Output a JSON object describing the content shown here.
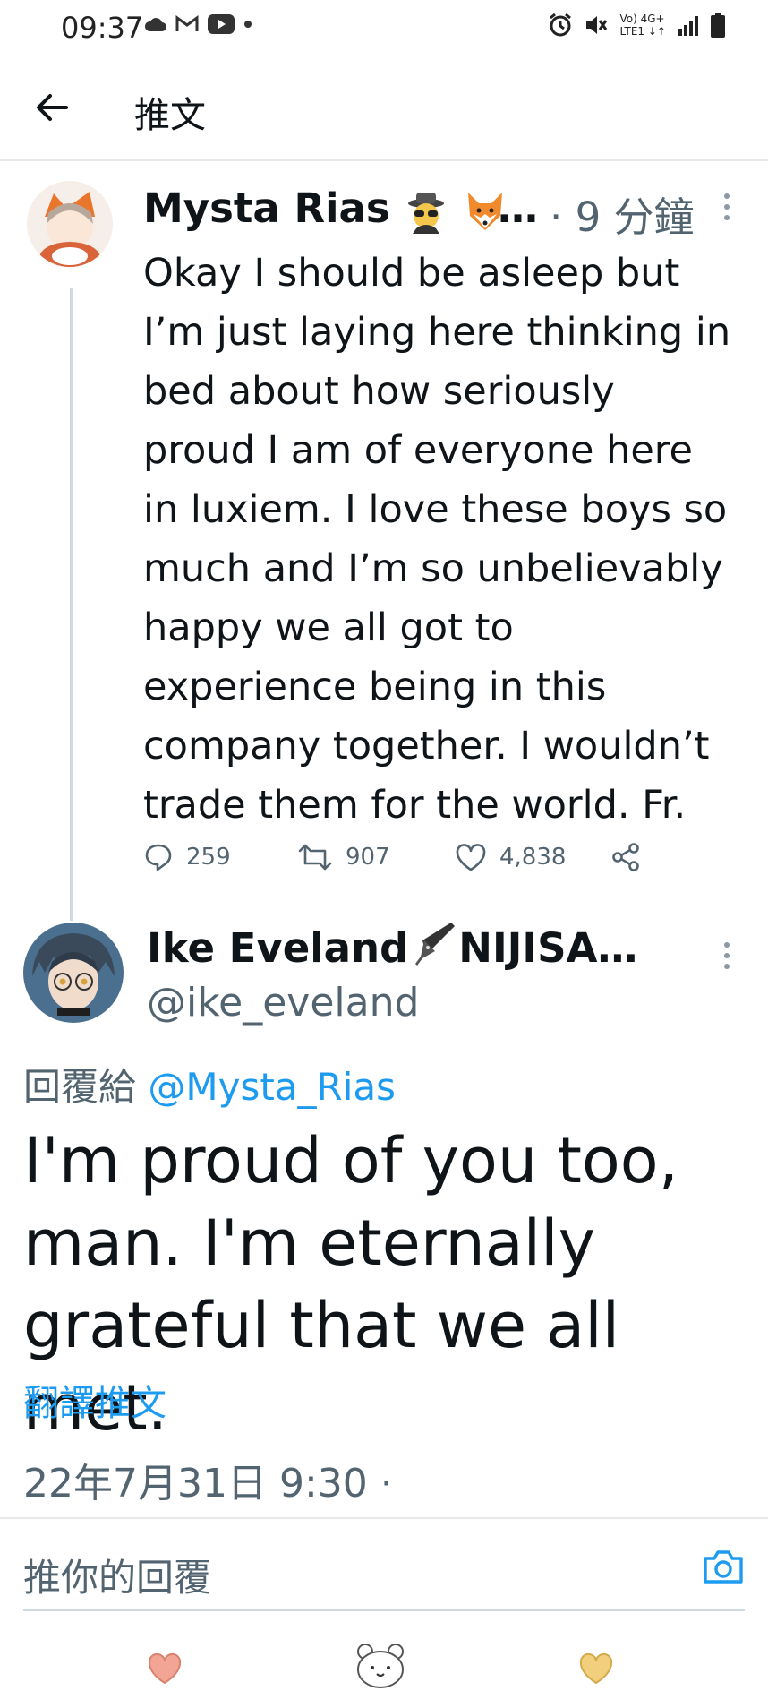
{
  "status_bar": {
    "time": "09:37",
    "network_label_top": "Vo) 4G+",
    "network_label_bottom": "LTE1 ↓↑"
  },
  "header": {
    "back_icon": "arrow-left-icon",
    "title": "推文"
  },
  "tweet_parent": {
    "display_name": "Mysta Rias",
    "name_suffix": "…",
    "emojis": [
      "detective-emoji",
      "fox-emoji"
    ],
    "time": "· 9 分鐘",
    "lines": [
      "Okay I should be asleep but",
      "I’m just laying here thinking in",
      "bed about how seriously",
      "proud I am of everyone here",
      "in luxiem. I love these boys so",
      "much and I’m so unbelievably",
      "happy we all got to",
      "experience being in this",
      "company together. I wouldn’t",
      "trade them for the world. Fr."
    ],
    "replies": "259",
    "retweets": "907",
    "likes": "4,838"
  },
  "tweet_main": {
    "display_name": "Ike Eveland",
    "name_tail": "NIJISA…",
    "handle": "@ike_eveland",
    "reply_prefix": "回覆給",
    "reply_mention": "@Mysta_Rias",
    "lines": [
      "I'm proud of you too,",
      "man. I'm eternally",
      "grateful that we all met."
    ],
    "translate": "翻譯推文",
    "datetime": "22年7月31日 9:30 ·"
  },
  "composer": {
    "placeholder": "推你的回覆"
  },
  "colors": {
    "accent": "#1d9bf0",
    "text": "#0f1419",
    "secondary": "#536471",
    "border": "#e7e9ea"
  }
}
